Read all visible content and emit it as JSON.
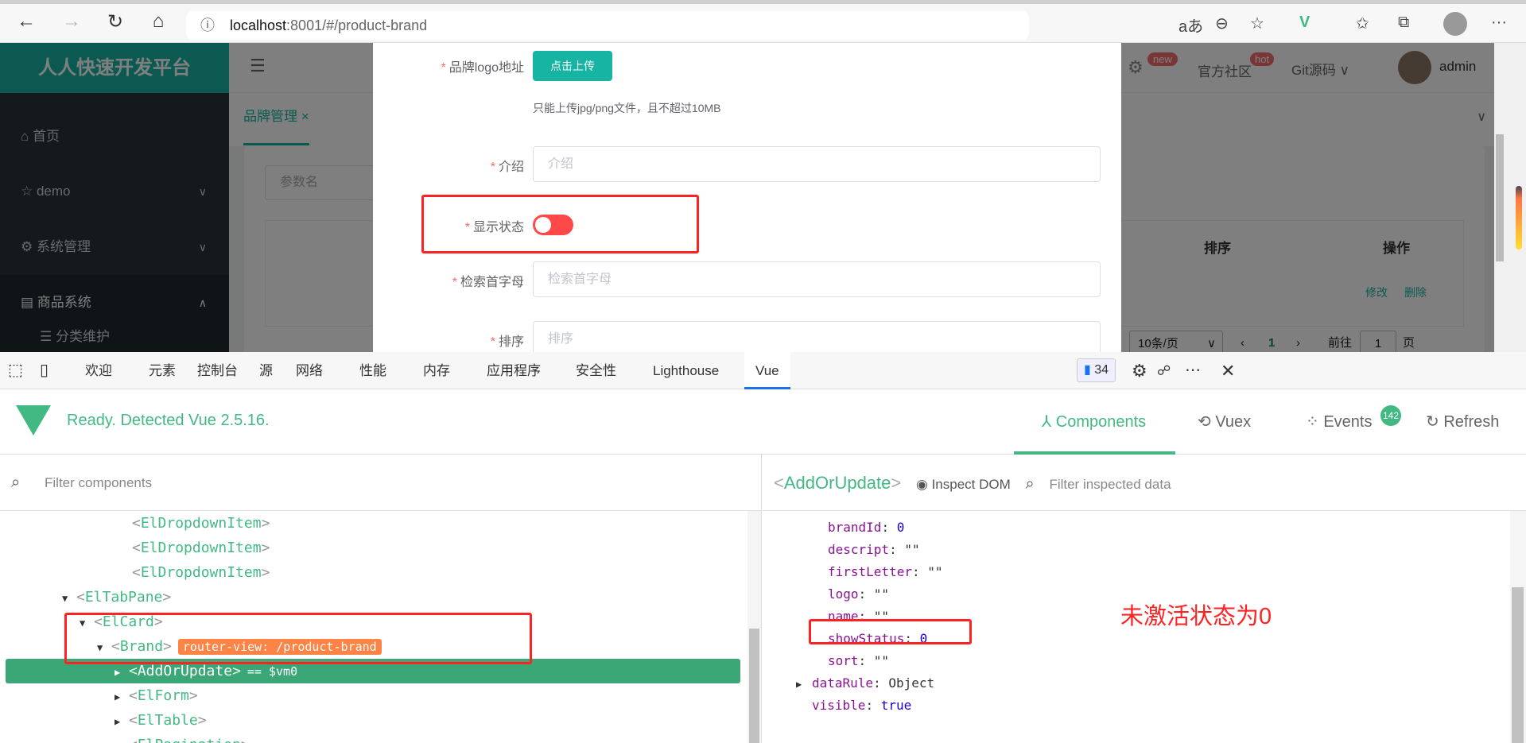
{
  "browser": {
    "url_host": "localhost",
    "url_path": ":8001/#/product-brand",
    "icons": [
      "back-icon",
      "forward-icon",
      "refresh-icon",
      "home-icon",
      "info-icon",
      "read-aloud-icon",
      "zoom-out-icon",
      "add-favorite-icon",
      "vue-devtools-icon",
      "favorites-icon",
      "collections-icon",
      "profile-icon",
      "more-icon"
    ]
  },
  "app": {
    "logo": "人人快速开发平台",
    "sidebar": [
      {
        "label": "首页",
        "icon": "home-icon"
      },
      {
        "label": "demo",
        "icon": "star-icon"
      },
      {
        "label": "系统管理",
        "icon": "gear-icon"
      },
      {
        "label": "商品系统",
        "icon": "doc-icon"
      },
      {
        "label": "分类维护",
        "icon": "list-icon"
      }
    ],
    "header": {
      "badge_new": "new",
      "community": "官方社区",
      "badge_hot": "hot",
      "git": "Git源码",
      "user": "admin"
    },
    "tab": "品牌管理",
    "search_placeholder": "参数名",
    "table_headers": [
      "排序",
      "操作"
    ],
    "row_actions": [
      "修改",
      "删除"
    ],
    "pager": {
      "size": "10条/页",
      "page": "1",
      "goto": "前往",
      "goto_value": "1",
      "page_unit": "页"
    }
  },
  "modal": {
    "logo_label": "品牌logo地址",
    "upload": "点击上传",
    "hint": "只能上传jpg/png文件，且不超过10MB",
    "descript_label": "介绍",
    "descript_placeholder": "介绍",
    "status_label": "显示状态",
    "status_on": false,
    "first_letter_label": "检索首字母",
    "first_letter_placeholder": "检索首字母",
    "sort_label": "排序",
    "sort_placeholder": "排序"
  },
  "devtools": {
    "tabs": [
      "欢迎",
      "元素",
      "控制台",
      "源",
      "网络",
      "性能",
      "内存",
      "应用程序",
      "安全性",
      "Lighthouse",
      "Vue"
    ],
    "active_tab": "Vue",
    "issues": "34",
    "vue": {
      "status": "Ready. Detected Vue 2.5.16.",
      "tabs": [
        "Components",
        "Vuex",
        "Events",
        "Refresh"
      ],
      "events_badge": "142",
      "filter_components": "Filter components",
      "selected": "AddOrUpdate",
      "inspect_dom": "Inspect DOM",
      "filter_data": "Filter inspected data",
      "tree": [
        {
          "name": "ElDropdownItem",
          "arrow": ""
        },
        {
          "name": "ElDropdownItem",
          "arrow": ""
        },
        {
          "name": "ElDropdownItem",
          "arrow": ""
        },
        {
          "name": "ElTabPane",
          "arrow": "▼"
        },
        {
          "name": "ElCard",
          "arrow": "▼"
        },
        {
          "name": "Brand",
          "arrow": "▼",
          "tag": "router-view: /product-brand"
        },
        {
          "name": "AddOrUpdate",
          "arrow": "▶",
          "suffix": "== $vm0"
        },
        {
          "name": "ElForm",
          "arrow": "▶"
        },
        {
          "name": "ElTable",
          "arrow": "▶"
        },
        {
          "name": "ElPagination",
          "arrow": "▶"
        }
      ],
      "props": [
        {
          "k": "brandId",
          "v": "0",
          "t": "num"
        },
        {
          "k": "descript",
          "v": "\"\"",
          "t": "str"
        },
        {
          "k": "firstLetter",
          "v": "\"\"",
          "t": "str"
        },
        {
          "k": "logo",
          "v": "\"\"",
          "t": "str"
        },
        {
          "k": "name",
          "v": "\"\"",
          "t": "str"
        },
        {
          "k": "showStatus",
          "v": "0",
          "t": "num"
        },
        {
          "k": "sort",
          "v": "\"\"",
          "t": "str"
        },
        {
          "k": "dataRule",
          "v": "Object",
          "t": "str",
          "arrow": "▶"
        },
        {
          "k": "visible",
          "v": "true",
          "t": "num"
        }
      ]
    }
  },
  "annotation": "未激活状态为0",
  "colors": {
    "accent": "#17b3a3",
    "vue_green": "#42b983",
    "switch_off": "#ff4949",
    "annotation": "#ff2222"
  }
}
